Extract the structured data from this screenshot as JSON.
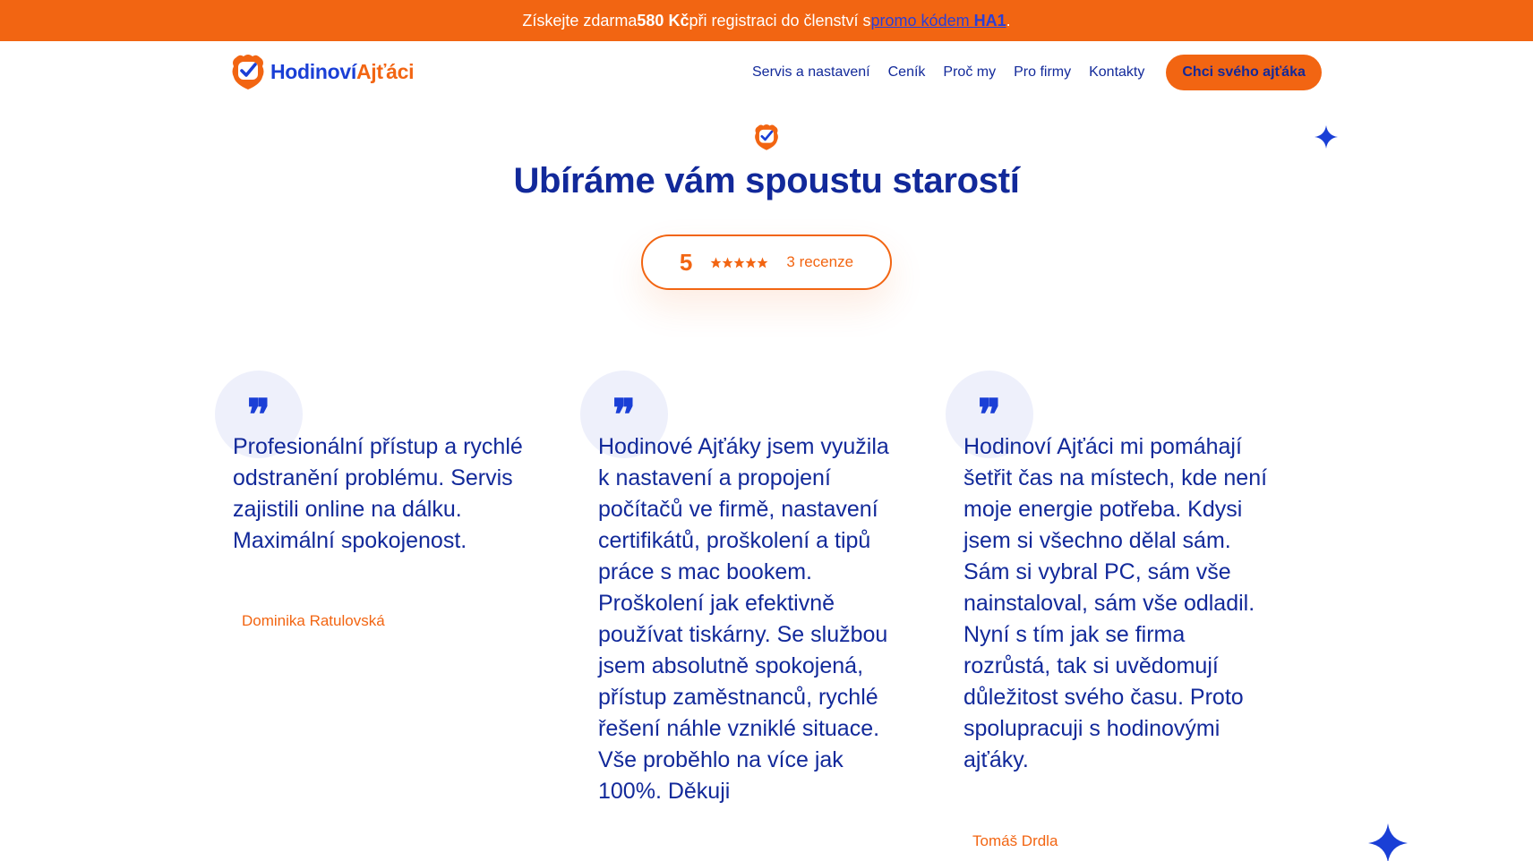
{
  "promo": {
    "pre": "Získejte zdarma ",
    "amount": "580 Kč",
    "mid": " při registraci do členství s ",
    "link_text": "promo kódem ",
    "code": "HA1",
    "post": "."
  },
  "header": {
    "logo_part1": "Hodinoví",
    "logo_part2": "Ajťáci",
    "nav": [
      "Servis a nastavení",
      "Ceník",
      "Proč my",
      "Pro firmy",
      "Kontakty"
    ],
    "cta": "Chci svého ajťáka"
  },
  "section": {
    "title": "Ubíráme vám spoustu starostí",
    "rating_score": "5",
    "rating_stars": 5,
    "rating_count": "3 recenze"
  },
  "reviews": [
    {
      "quote": "❞",
      "text": "Profesionální přístup a rychlé odstranění problému. Servis zajistili online na dálku. Maximální spokojenost.",
      "author": "Dominika Ratulovská"
    },
    {
      "quote": "❞",
      "text": "Hodinové Ajťáky jsem využila k nastavení a propojení počítačů ve firmě, nastavení certifikátů, proškolení a tipů práce s mac bookem. Proškolení jak efektivně používat tiskárny. Se službou jsem absolutně spokojená, přístup zaměstnanců, rychlé řešení náhle vzniklé situace. Vše proběhlo na více jak 100%. Děkuji",
      "author": ""
    },
    {
      "quote": "❞",
      "text": "Hodinoví Ajťáci mi pomáhají šetřit čas na místech, kde není moje energie potřeba. Kdysi jsem si všechno dělal sám. Sám si vybral PC, sám vše nainstaloval, sám vše odladil. Nyní s tím jak se firma rozrůstá, tak si uvědomují důležitost svého času. Proto spolupracuji s hodinovými ajťáky.",
      "author": "Tomáš Drdla"
    }
  ],
  "colors": {
    "accent": "#f26512",
    "brand": "#1a3fd6",
    "text": "#12299a"
  },
  "icons": [
    "shield-check-icon",
    "star-icon",
    "sparkle-icon",
    "quote-icon"
  ]
}
